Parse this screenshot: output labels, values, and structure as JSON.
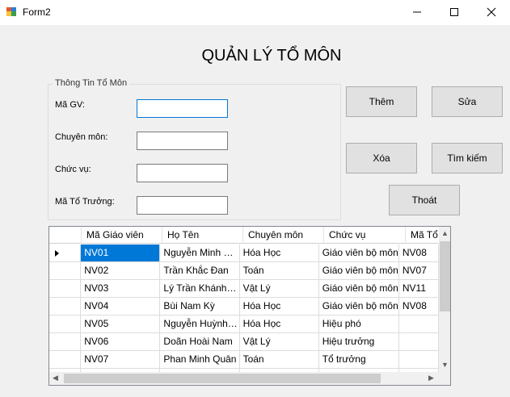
{
  "window": {
    "title": "Form2"
  },
  "heading": "QUẢN LÝ TỔ MÔN",
  "group": {
    "legend": "Thông Tin Tổ Môn",
    "fields": [
      {
        "label": "Mã GV:",
        "value": ""
      },
      {
        "label": "Chuyên môn:",
        "value": ""
      },
      {
        "label": "Chức vụ:",
        "value": ""
      },
      {
        "label": "Mã Tổ Trưởng:",
        "value": ""
      }
    ]
  },
  "buttons": {
    "add": "Thêm",
    "edit": "Sửa",
    "delete": "Xóa",
    "search": "Tìm kiếm",
    "exit": "Thoát"
  },
  "grid": {
    "columns": [
      "Mã Giáo viên",
      "Họ Tên",
      "Chuyên môn",
      "Chức vụ",
      "Mã Tổ"
    ],
    "rows": [
      [
        "NV01",
        "Nguyễn Minh Hoài",
        "Hóa Học",
        "Giáo viên bộ môn",
        "NV08"
      ],
      [
        "NV02",
        "Trần Khắc Đan",
        "Toán",
        "Giáo viên bộ môn",
        "NV07"
      ],
      [
        "NV03",
        "Lý Trần Khánh N...",
        "Vật Lý",
        "Giáo viên bộ môn",
        "NV11"
      ],
      [
        "NV04",
        "Bùi Nam Kỳ",
        "Hóa Học",
        "Giáo viên bộ môn",
        "NV08"
      ],
      [
        "NV05",
        "Nguyễn Huỳnh Ma...",
        "Hóa Học",
        "Hiệu phó",
        ""
      ],
      [
        "NV06",
        "Doãn Hoài Nam",
        "Vật Lý",
        "Hiệu trưởng",
        ""
      ],
      [
        "NV07",
        "Phan Minh Quân",
        "Toán",
        "Tổ trưởng",
        ""
      ],
      [
        "",
        "",
        "",
        "",
        ""
      ]
    ]
  },
  "colors": {
    "selection": "#0078d7",
    "focus_border": "#0078d7"
  }
}
